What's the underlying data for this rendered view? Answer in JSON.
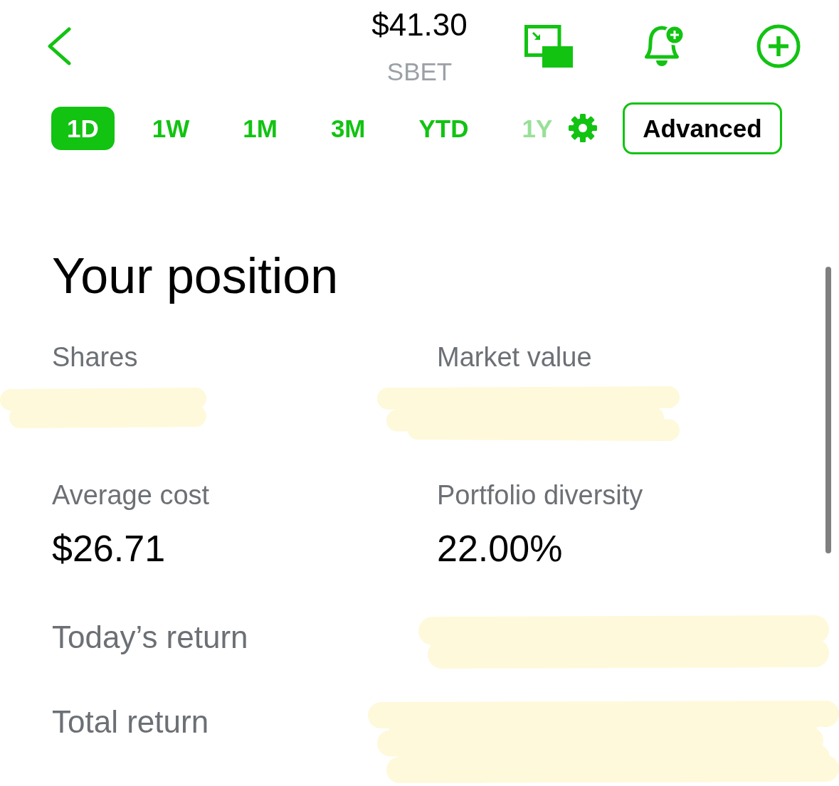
{
  "header": {
    "price": "$41.30",
    "ticker": "SBET"
  },
  "timeframes": [
    {
      "label": "1D",
      "selected": true,
      "dimmed": false
    },
    {
      "label": "1W",
      "selected": false,
      "dimmed": false
    },
    {
      "label": "1M",
      "selected": false,
      "dimmed": false
    },
    {
      "label": "3M",
      "selected": false,
      "dimmed": false
    },
    {
      "label": "YTD",
      "selected": false,
      "dimmed": false
    },
    {
      "label": "1Y",
      "selected": false,
      "dimmed": true
    }
  ],
  "advanced_button": {
    "label": "Advanced"
  },
  "position": {
    "title": "Your position",
    "stats": [
      {
        "label": "Shares",
        "kind": "redacted"
      },
      {
        "label": "Market value",
        "kind": "redacted"
      },
      {
        "label": "Average cost",
        "kind": "value",
        "value": "$26.71"
      },
      {
        "label": "Portfolio diversity",
        "kind": "value",
        "value": "22.00%"
      }
    ],
    "returns": [
      {
        "label": "Today’s return",
        "kind": "redacted"
      },
      {
        "label": "Total return",
        "kind": "redacted"
      }
    ]
  }
}
